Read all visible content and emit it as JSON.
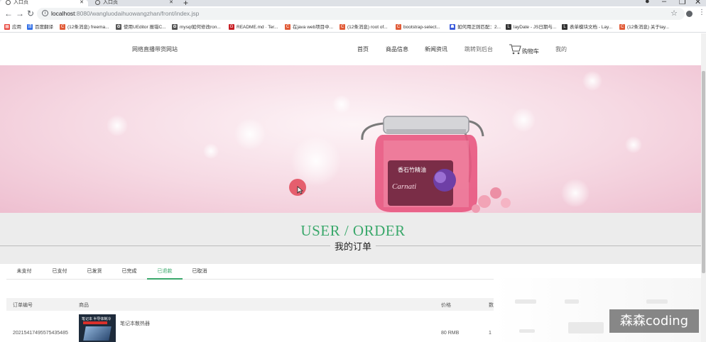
{
  "browser": {
    "tabs": [
      {
        "title": "入口页",
        "active": true
      },
      {
        "title": "入口页",
        "active": false
      }
    ],
    "new_tab_icon": "plus-icon",
    "url_host": "localhost",
    "url_rest": ":8080/wangluodaihuowangzhan/front/index.jsp",
    "bookmarks": [
      {
        "label": "应用",
        "icon": "apps-grid-icon",
        "color": "#e8453c"
      },
      {
        "label": "百度翻译",
        "icon": "translate-icon",
        "color": "#2f6ee7"
      },
      {
        "label": "(12条消息) freema...",
        "icon": "csdn-icon",
        "color": "#e15b37"
      },
      {
        "label": "使用UEditor 报错C...",
        "icon": "cnblogs-icon",
        "color": "#555555"
      },
      {
        "label": "mysql如何修改ron...",
        "icon": "cnblogs-icon",
        "color": "#555555"
      },
      {
        "label": "README.md · Ter...",
        "icon": "gitee-icon",
        "color": "#c71d23"
      },
      {
        "label": "在java web项目中...",
        "icon": "csdn-icon",
        "color": "#e15b37"
      },
      {
        "label": "(12条消息) root of...",
        "icon": "csdn-icon",
        "color": "#e15b37"
      },
      {
        "label": "bootstrap-select...",
        "icon": "csdn-icon",
        "color": "#e15b37"
      },
      {
        "label": "如何用正则匹配：2...",
        "icon": "baidu-icon",
        "color": "#3b5bdb"
      },
      {
        "label": "layDate - JS日期与...",
        "icon": "layui-icon",
        "color": "#333333"
      },
      {
        "label": "表单模块文档 - Lay...",
        "icon": "layui-icon",
        "color": "#333333"
      },
      {
        "label": "(12条消息) 关于lay...",
        "icon": "csdn-icon",
        "color": "#e15b37"
      }
    ]
  },
  "site": {
    "title": "网络直播带货网站",
    "nav": [
      {
        "label": "首页"
      },
      {
        "label": "商品信息"
      },
      {
        "label": "新闻资讯"
      },
      {
        "label": "跳转到后台"
      },
      {
        "label": "购物车"
      },
      {
        "label": "我的"
      }
    ]
  },
  "order": {
    "title": "USER / ORDER",
    "subtitle": "我的订单",
    "tabs": [
      {
        "label": "未支付",
        "active": false
      },
      {
        "label": "已支付",
        "active": false
      },
      {
        "label": "已发货",
        "active": false
      },
      {
        "label": "已完成",
        "active": false
      },
      {
        "label": "已退款",
        "active": true
      },
      {
        "label": "已取消",
        "active": false
      }
    ],
    "columns": [
      "订单编号",
      "商品",
      "价格",
      "数"
    ],
    "rows": [
      {
        "order_no": "20215417495575435485",
        "product_name": "笔记本散热器",
        "thumb_text": "笔记本 半导体制冷",
        "price": "80 RMB",
        "qty": "1"
      }
    ]
  },
  "watermark": "森森coding",
  "colors": {
    "accent": "#3aa86b",
    "banner_pink": "#f6d9e3",
    "cursor_dot": "#e24858"
  }
}
